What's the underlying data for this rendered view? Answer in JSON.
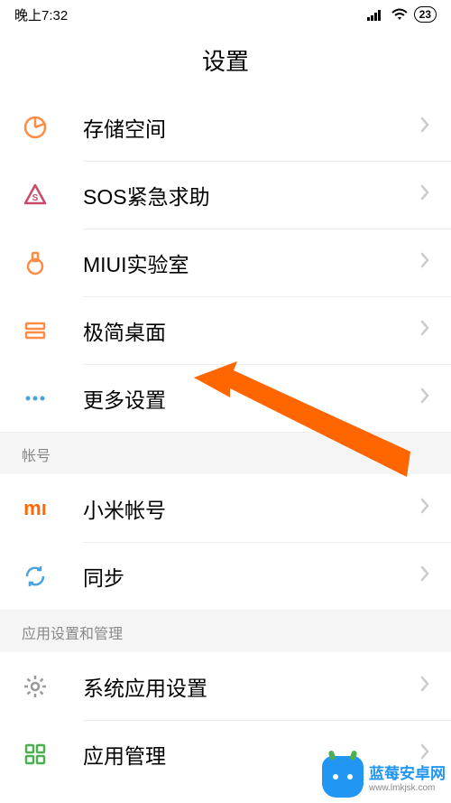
{
  "status_bar": {
    "time": "晚上7:32",
    "battery": "23"
  },
  "title": "设置",
  "rows": {
    "storage": {
      "label": "存储空间",
      "icon": "storage-icon",
      "color": "#ff8c42"
    },
    "sos": {
      "label": "SOS紧急求助",
      "icon": "sos-icon",
      "color": "#c94a6a"
    },
    "lab": {
      "label": "MIUI实验室",
      "icon": "lab-icon",
      "color": "#ff8c42"
    },
    "simple": {
      "label": "极简桌面",
      "icon": "simple-icon",
      "color": "#ff8c42"
    },
    "more": {
      "label": "更多设置",
      "icon": "more-icon",
      "color": "#4aa3df"
    },
    "mi": {
      "label": "小米帐号",
      "icon": "mi-icon",
      "color": "#ff6700"
    },
    "sync": {
      "label": "同步",
      "icon": "sync-icon",
      "color": "#4aa3df"
    },
    "sysapp": {
      "label": "系统应用设置",
      "icon": "gear-icon",
      "color": "#999999"
    },
    "appmgmt": {
      "label": "应用管理",
      "icon": "apps-icon",
      "color": "#4caf50"
    }
  },
  "sections": {
    "account": "帐号",
    "apps": "应用设置和管理"
  },
  "watermark": {
    "title": "蓝莓安卓网",
    "url": "www.lmkjsk.com"
  }
}
